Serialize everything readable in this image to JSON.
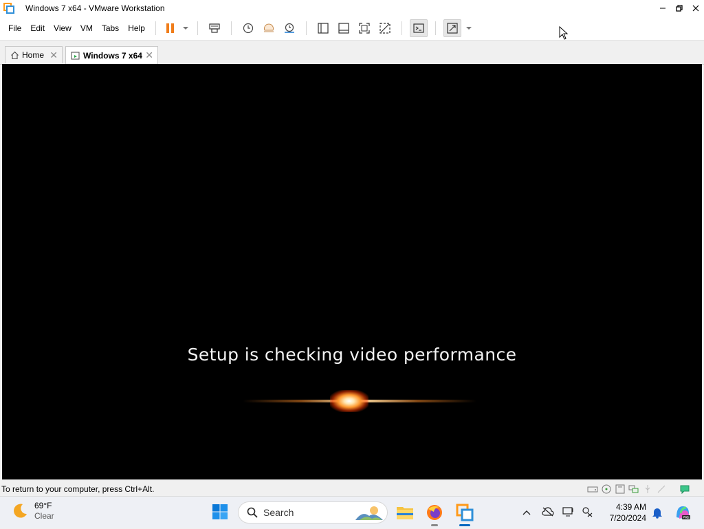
{
  "window": {
    "title": "Windows 7 x64 - VMware Workstation",
    "controls": [
      "minimize",
      "restore",
      "close"
    ]
  },
  "menu": {
    "items": [
      "File",
      "Edit",
      "View",
      "VM",
      "Tabs",
      "Help"
    ]
  },
  "toolbar": {
    "buttons": [
      "pause-vm",
      "send-ctrl-alt-del",
      "take-snapshot",
      "revert-snapshot",
      "snapshot-manager",
      "show-library",
      "show-thumbnail-bar",
      "full-screen",
      "unity",
      "console-view",
      "stretch-guest"
    ]
  },
  "tabs": [
    {
      "label": "Home",
      "icon": "home-icon",
      "active": false
    },
    {
      "label": "Windows 7 x64",
      "icon": "vm-icon",
      "active": true
    }
  ],
  "vm": {
    "message": "Setup is checking video performance"
  },
  "statusbar": {
    "text": "To return to your computer, press Ctrl+Alt."
  },
  "taskbar": {
    "weather": {
      "temp": "69°F",
      "desc": "Clear"
    },
    "search_placeholder": "Search",
    "apps": [
      "file-explorer",
      "firefox",
      "vmware-workstation"
    ],
    "clock": {
      "time": "4:39 AM",
      "date": "7/20/2024"
    }
  },
  "colors": {
    "accent": "#0067c0",
    "pause": "#f07d1a",
    "vm_background": "#000000"
  }
}
